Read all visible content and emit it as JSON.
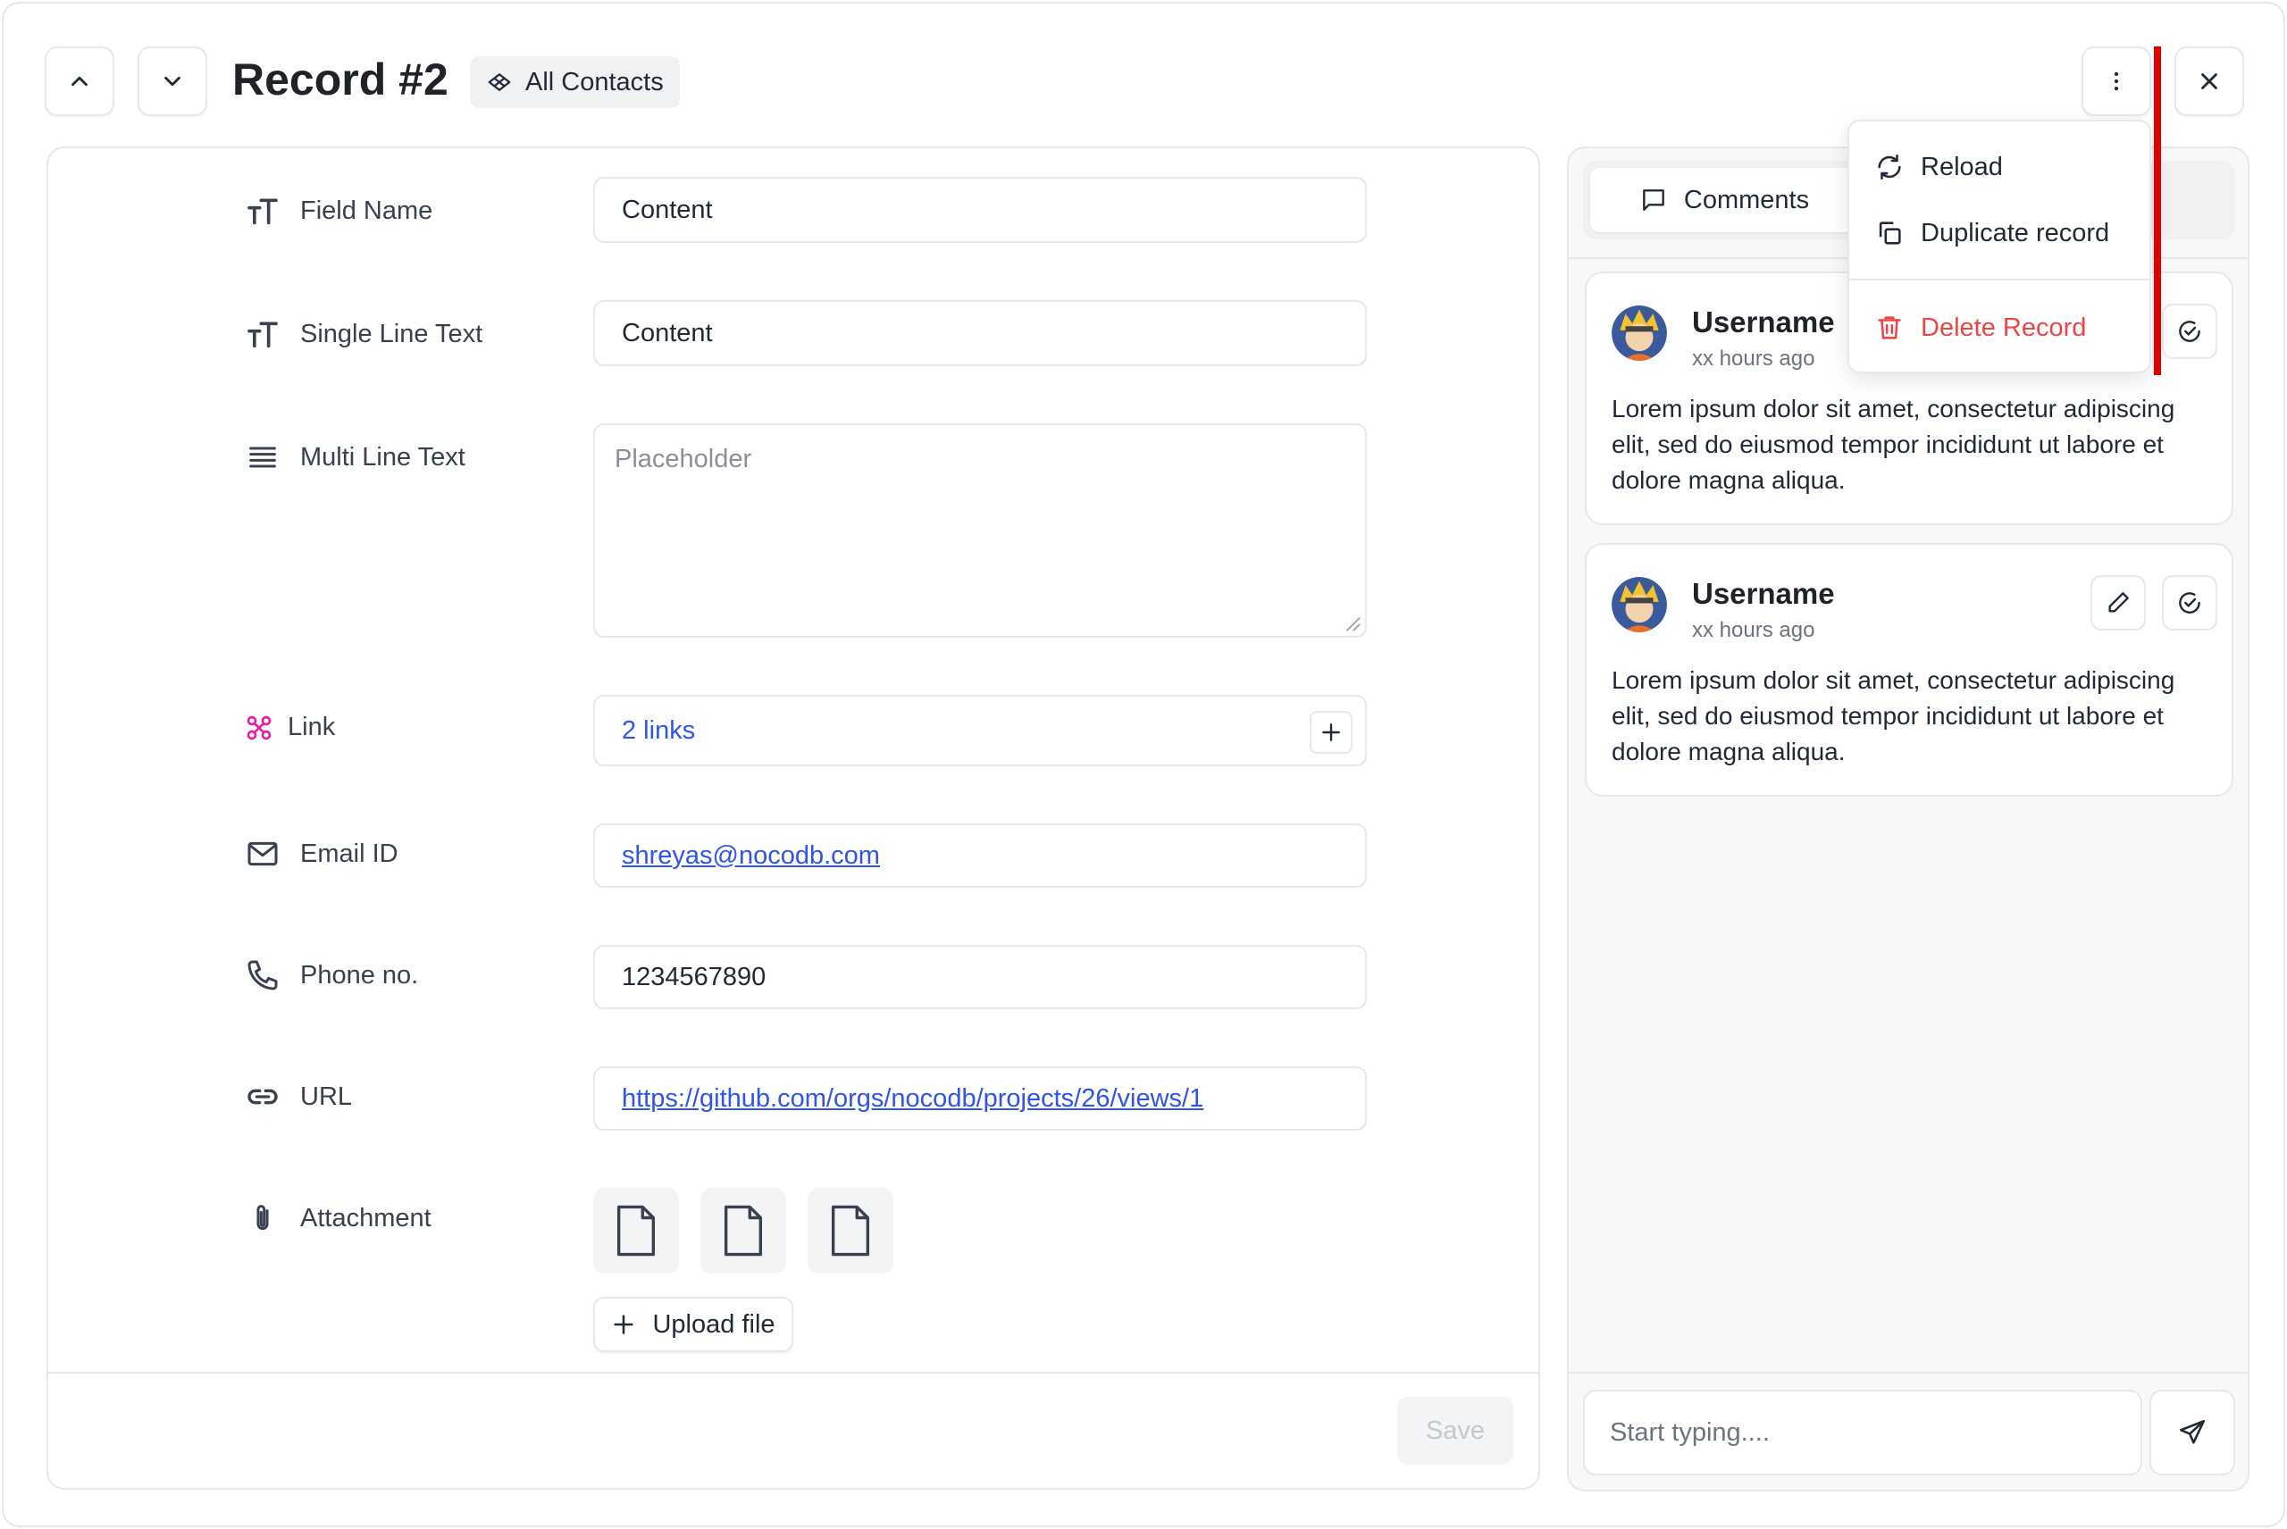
{
  "header": {
    "title": "Record #2",
    "view_chip": "All Contacts"
  },
  "fields": [
    {
      "label": "Field Name",
      "icon": "text-type-icon",
      "value": "Content"
    },
    {
      "label": "Single Line Text",
      "icon": "text-type-icon",
      "value": "Content"
    },
    {
      "label": "Multi Line Text",
      "icon": "paragraph-lines-icon",
      "placeholder": "Placeholder"
    },
    {
      "label": "Link",
      "icon": "link-node-icon",
      "value": "2 links"
    },
    {
      "label": "Email ID",
      "icon": "mail-icon",
      "value": "shreyas@nocodb.com"
    },
    {
      "label": "Phone no.",
      "icon": "phone-icon",
      "value": "1234567890"
    },
    {
      "label": "URL",
      "icon": "chain-link-icon",
      "value": "https://github.com/orgs/nocodb/projects/26/views/1"
    },
    {
      "label": "Attachment",
      "icon": "paperclip-icon"
    }
  ],
  "upload_label": "Upload file",
  "save_label": "Save",
  "comments": {
    "tab_label": "Comments",
    "items": [
      {
        "username": "Username",
        "time": "xx hours ago",
        "text": "Lorem ipsum dolor sit amet, consectetur adipiscing elit, sed do eiusmod tempor incididunt ut labore et dolore magna aliqua."
      },
      {
        "username": "Username",
        "time": "xx hours ago",
        "text": "Lorem ipsum dolor sit amet, consectetur adipiscing elit, sed do eiusmod tempor incididunt ut labore et dolore magna aliqua."
      }
    ],
    "input_placeholder": "Start typing...."
  },
  "menu": {
    "reload": "Reload",
    "duplicate": "Duplicate record",
    "delete": "Delete Record"
  },
  "colors": {
    "link_blue": "#2f54eb",
    "danger_red": "#ef4444",
    "link_icon_pink": "#e51fa6",
    "annotation_red": "#e10000"
  }
}
